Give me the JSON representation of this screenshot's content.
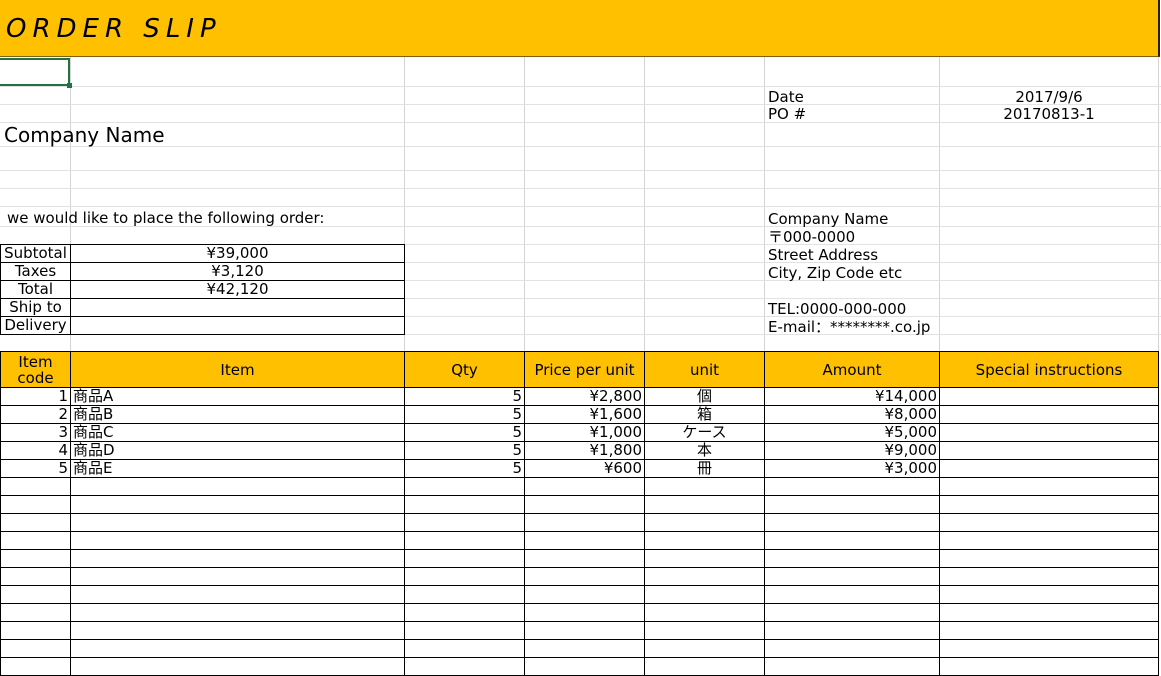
{
  "title": "ORDER SLIP",
  "meta": {
    "date_label": "Date",
    "date_value": "2017/9/6",
    "po_label": "PO #",
    "po_value": "20170813-1"
  },
  "company_name": "Company Name",
  "intro": "we would like to place the following order:",
  "summary": [
    {
      "label": "Subtotal",
      "value": "¥39,000"
    },
    {
      "label": "Taxes",
      "value": "¥3,120"
    },
    {
      "label": "Total",
      "value": "¥42,120"
    },
    {
      "label": "Ship to",
      "value": ""
    },
    {
      "label": "Delivery",
      "value": ""
    }
  ],
  "sender": {
    "company": "Company Name",
    "postal": "〒000-0000",
    "street": "Street Address",
    "city": "City, Zip Code etc",
    "tel": "TEL:0000-000-000",
    "email": "E-mail：********.co.jp"
  },
  "table": {
    "headers": {
      "code_line1": "Item",
      "code_line2": "code",
      "item": "Item",
      "qty": "Qty",
      "price": "Price per unit",
      "unit": "unit",
      "amount": "Amount",
      "special": "Special instructions"
    },
    "rows": [
      {
        "code": "1",
        "item": "商品A",
        "qty": "5",
        "price": "¥2,800",
        "unit": "個",
        "amount": "¥14,000",
        "special": ""
      },
      {
        "code": "2",
        "item": "商品B",
        "qty": "5",
        "price": "¥1,600",
        "unit": "箱",
        "amount": "¥8,000",
        "special": ""
      },
      {
        "code": "3",
        "item": "商品C",
        "qty": "5",
        "price": "¥1,000",
        "unit": "ケース",
        "amount": "¥5,000",
        "special": ""
      },
      {
        "code": "4",
        "item": "商品D",
        "qty": "5",
        "price": "¥1,800",
        "unit": "本",
        "amount": "¥9,000",
        "special": ""
      },
      {
        "code": "5",
        "item": "商品E",
        "qty": "5",
        "price": "¥600",
        "unit": "冊",
        "amount": "¥3,000",
        "special": ""
      }
    ],
    "empty_rows": 11
  }
}
